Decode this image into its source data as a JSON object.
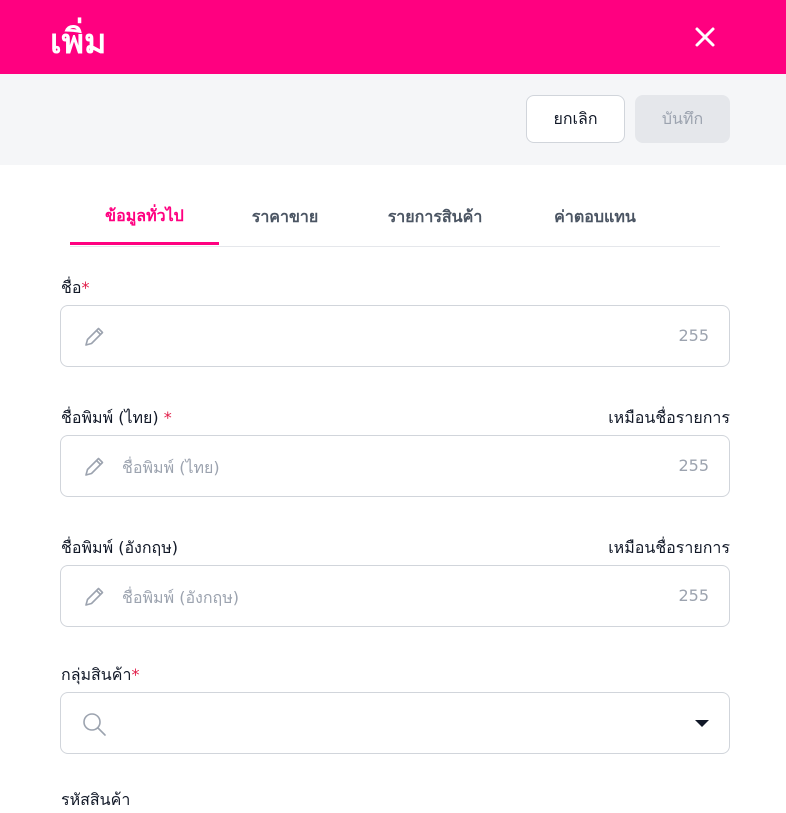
{
  "header": {
    "title": "เพิ่ม"
  },
  "actions": {
    "cancel_label": "ยกเลิก",
    "save_label": "บันทึก"
  },
  "tabs": [
    {
      "label": "ข้อมูลทั่วไป",
      "active": true
    },
    {
      "label": "ราคาขาย",
      "active": false
    },
    {
      "label": "รายการสินค้า",
      "active": false
    },
    {
      "label": "ค่าตอบแทน",
      "active": false
    }
  ],
  "form": {
    "name": {
      "label": "ชื่อ",
      "required": "*",
      "placeholder": "",
      "count": "255"
    },
    "print_th": {
      "label": "ชื่อพิมพ์ (ไทย)",
      "required": "*",
      "link": "เหมือนชื่อรายการ",
      "placeholder": "ชื่อพิมพ์ (ไทย)",
      "count": "255"
    },
    "print_en": {
      "label": "ชื่อพิมพ์ (อังกฤษ)",
      "link": "เหมือนชื่อรายการ",
      "placeholder": "ชื่อพิมพ์ (อังกฤษ)",
      "count": "255"
    },
    "group": {
      "label": "กลุ่มสินค้า",
      "required": "*",
      "placeholder": ""
    },
    "code": {
      "label": "รหัสสินค้า"
    }
  },
  "colors": {
    "brand": "#ff0080",
    "background": "#f5f6f8"
  }
}
